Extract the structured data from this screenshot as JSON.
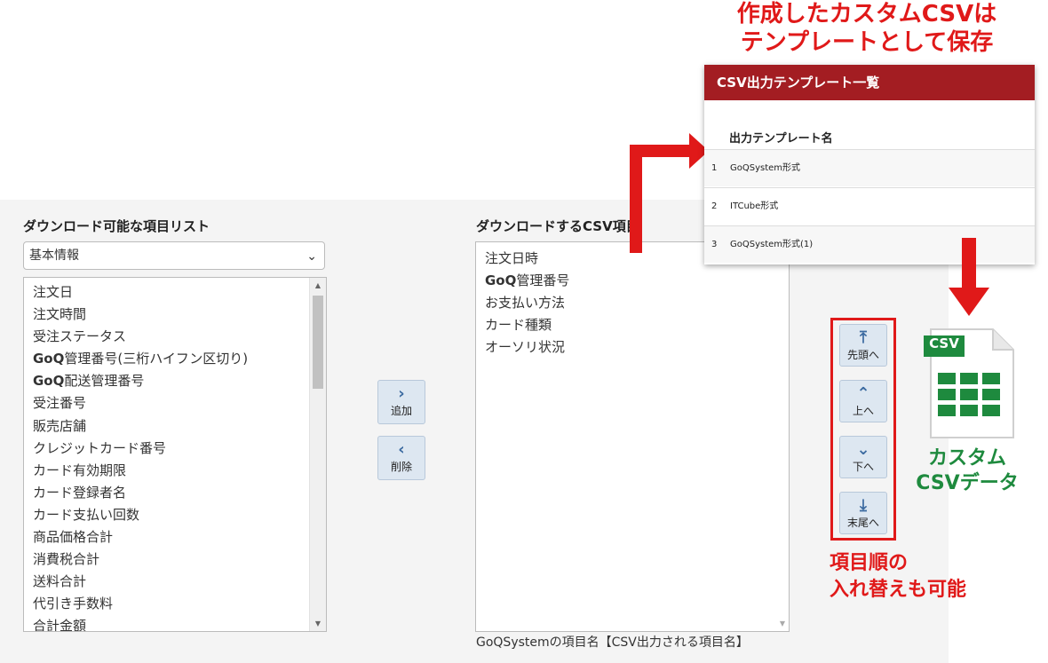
{
  "annotations": {
    "top_line1": "作成したカスタムCSVは",
    "top_line2": "テンプレートとして保存",
    "order_line1": "項目順の",
    "order_line2": "入れ替えも可能",
    "csv_line1": "カスタム",
    "csv_line2": "CSVデータ",
    "csv_badge": "CSV"
  },
  "left": {
    "heading": "ダウンロード可能な項目リスト",
    "select_value": "基本情報",
    "items": [
      {
        "bold": "",
        "text": "注文日"
      },
      {
        "bold": "",
        "text": "注文時間"
      },
      {
        "bold": "",
        "text": "受注ステータス"
      },
      {
        "bold": "GoQ",
        "text": "管理番号(三桁ハイフン区切り)"
      },
      {
        "bold": "GoQ",
        "text": "配送管理番号"
      },
      {
        "bold": "",
        "text": "受注番号"
      },
      {
        "bold": "",
        "text": "販売店舗"
      },
      {
        "bold": "",
        "text": "クレジットカード番号"
      },
      {
        "bold": "",
        "text": "カード有効期限"
      },
      {
        "bold": "",
        "text": "カード登録者名"
      },
      {
        "bold": "",
        "text": "カード支払い回数"
      },
      {
        "bold": "",
        "text": "商品価格合計"
      },
      {
        "bold": "",
        "text": "消費税合計"
      },
      {
        "bold": "",
        "text": "送料合計"
      },
      {
        "bold": "",
        "text": "代引き手数料"
      },
      {
        "bold": "",
        "text": "合計金額"
      }
    ]
  },
  "middle_buttons": {
    "add": "追加",
    "remove": "削除"
  },
  "right": {
    "heading": "ダウンロードするCSV項目",
    "items": [
      {
        "bold": "",
        "text": "注文日時"
      },
      {
        "bold": "GoQ",
        "text": "管理番号"
      },
      {
        "bold": "",
        "text": "お支払い方法"
      },
      {
        "bold": "",
        "text": "カード種類"
      },
      {
        "bold": "",
        "text": "オーソリ状況"
      }
    ],
    "caption": "GoQSystemの項目名【CSV出力される項目名】"
  },
  "order_buttons": {
    "top": "先頭へ",
    "up": "上へ",
    "down": "下へ",
    "bottom": "末尾へ"
  },
  "template_popup": {
    "title": "CSV出力テンプレート一覧",
    "column_header": "出力テンプレート名",
    "rows": [
      {
        "num": "1",
        "name": "GoQSystem形式"
      },
      {
        "num": "2",
        "name": "ITCube形式"
      },
      {
        "num": "3",
        "name": "GoQSystem形式(1)"
      }
    ]
  },
  "colors": {
    "accent_red": "#e01919",
    "header_red": "#a31d22",
    "csv_green": "#1e8a3e",
    "button_bg": "#dde7f1"
  }
}
